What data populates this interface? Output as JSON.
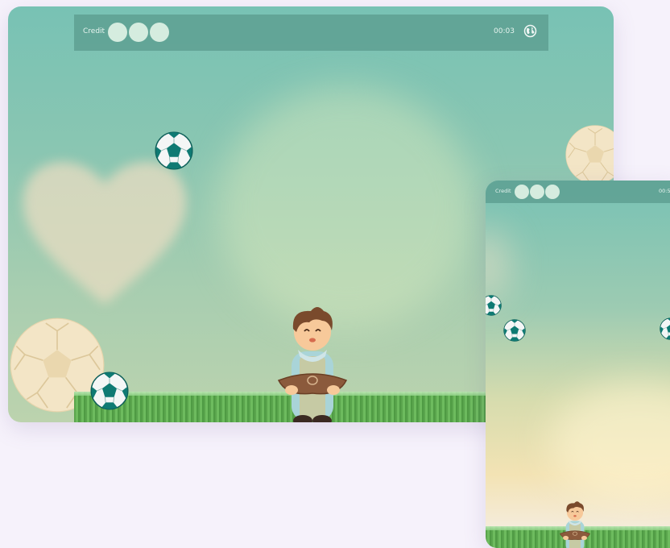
{
  "tablet": {
    "hud": {
      "credit_label": "Credit",
      "credit_lives": 3,
      "timer": "00:03",
      "globe_icon": "globe-icon"
    }
  },
  "phone": {
    "hud": {
      "credit_label": "Credit",
      "credit_lives": 3,
      "timer": "00:5"
    }
  },
  "colors": {
    "sky_top": "#78c2b4",
    "sky_bottom": "#bcd3ae",
    "hud_bar": "#5ea092",
    "life_dot": "#d5ecdf",
    "grass": "#5aa54d",
    "ball_teal": "#0f7a73",
    "big_ball": "#f2e3c2",
    "page_bg": "#f6f2fb"
  },
  "icons": [
    "soccer-ball-icon",
    "globe-icon",
    "boy-with-basket",
    "heart-cloud"
  ]
}
